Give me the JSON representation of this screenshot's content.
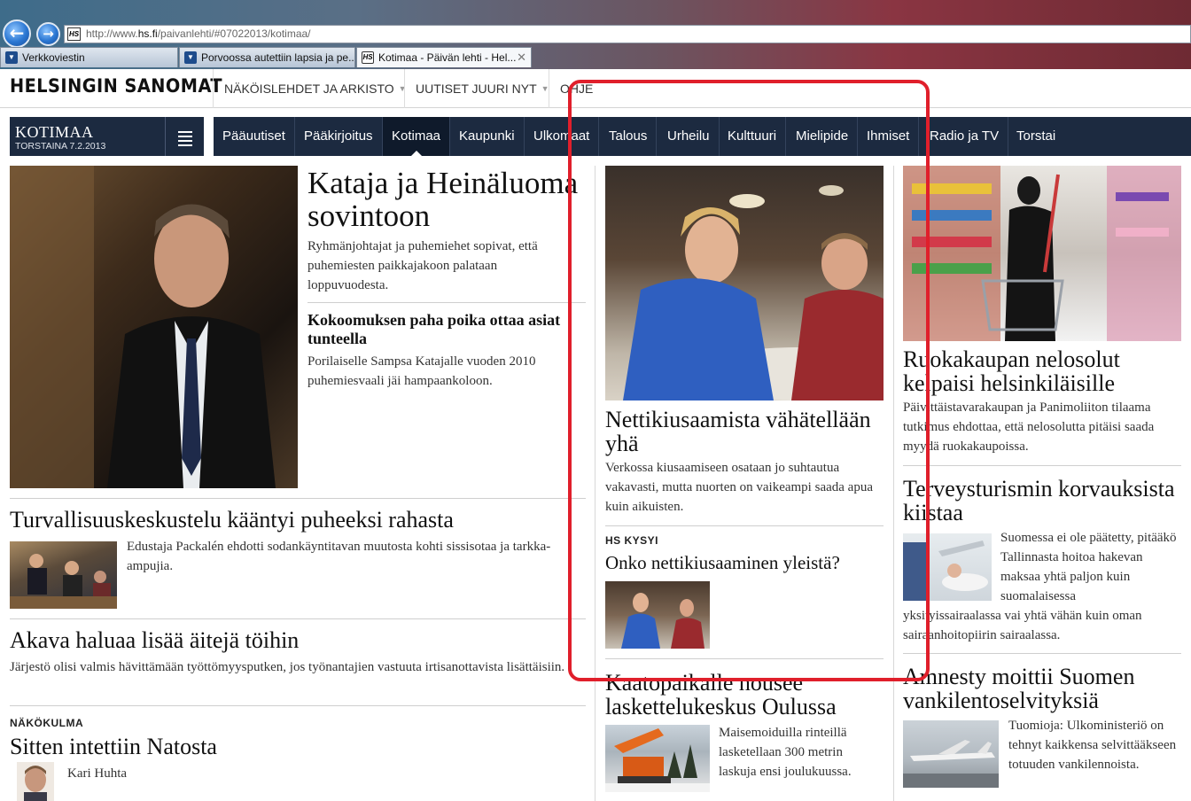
{
  "browser": {
    "url_prefix": "http://www.",
    "url_domain": "hs.fi",
    "url_path": "/paivanlehti/#07022013/kotimaa/",
    "url_favicon": "HS",
    "tabs": [
      {
        "label": "Verkkoviestin",
        "favicon": "▼"
      },
      {
        "label": "Porvoossa autettiin lapsia ja pe...",
        "favicon": "▼"
      },
      {
        "label": "Kotimaa - Päivän lehti - Hel...",
        "favicon": "HS",
        "close": "✕"
      }
    ]
  },
  "header": {
    "logo": "HELSINGIN SANOMAT",
    "top_links": [
      "NÄKÖISLEHDET JA ARKISTO",
      "UUTISET JUURI NYT",
      "OHJE"
    ],
    "caret": "▼"
  },
  "section": {
    "title": "KOTIMAA",
    "date": "TORSTAINA 7.2.2013"
  },
  "nav": {
    "items": [
      "Pääuutiset",
      "Pääkirjoitus",
      "Kotimaa",
      "Kaupunki",
      "Ulkomaat",
      "Talous",
      "Urheilu",
      "Kulttuuri",
      "Mielipide",
      "Ihmiset",
      "Radio ja TV",
      "Torstai"
    ],
    "active": "Kotimaa"
  },
  "left": {
    "lead_title": "Kataja ja Heinäluoma sovintoon",
    "lead_text": "Ryhmänjohtajat ja puhemiehet sopivat, että puhemiesten paikkajakoon palataan loppuvuodesta.",
    "sub_title": "Kokoomuksen paha poika ottaa asiat tunteella",
    "sub_text": "Porilaiselle Sampsa Katajalle vuoden 2010 puhemiesvaali jäi hampaankoloon.",
    "story2_title": "Turvallisuuskeskustelu kääntyi puheeksi rahasta",
    "story2_text": "Edustaja Packalén ehdotti sodankäyntitavan muutosta kohti sissisotaa ja tarkka-ampujia.",
    "story3_title": "Akava haluaa lisää äitejä töihin",
    "story3_text": "Järjestö olisi valmis hävittämään työttömyysputken, jos työnantajien vastuuta irtisanottavista lisättäisiin.",
    "kicker": "NÄKÖKULMA",
    "story4_title": "Sitten intettiin Natosta",
    "story4_author": "Kari Huhta"
  },
  "middle": {
    "title": "Nettikiusaamista vähätellään yhä",
    "text": "Verkossa kiusaamiseen osataan jo suhtautua vakavasti, mutta nuorten on vaikeampi saada apua kuin aikuisten.",
    "kicker": "HS KYSYI",
    "poll_title": "Onko nettikiusaaminen yleistä?",
    "story2_title": "Kaatopaikalle nousee laskettelukeskus Oulussa",
    "story2_text": "Maisemoiduilla rinteillä lasketellaan 300 metrin laskuja ensi joulukuussa."
  },
  "right": {
    "story1_title": "Ruokakaupan nelosolut kelpaisi helsinkiläisille",
    "story1_text": "Päivittäistavarakaupan ja Panimoliiton tilaama tutkimus ehdottaa, että nelosolutta pitäisi saada myydä ruokakaupoissa.",
    "story2_title": "Terveysturismin korvauksista kiistaa",
    "story2_text_a": "Suomessa ei ole päätetty, pitääkö Tallinnasta hoitoa hakevan maksaa yhtä paljon kuin suomalaisessa",
    "story2_text_b": "yksityissairaalassa vai yhtä vähän kuin oman sairaanhoitopiirin sairaalassa.",
    "story3_title": "Amnesty moittii Suomen vankilentoselvityksiä",
    "story3_text": "Tuomioja: Ulkoministeriö on tehnyt kaikkensa selvittääkseen totuuden vankilennoista."
  },
  "colors": {
    "nav_bg": "#1c2a40",
    "annotation": "#e01f2b"
  }
}
